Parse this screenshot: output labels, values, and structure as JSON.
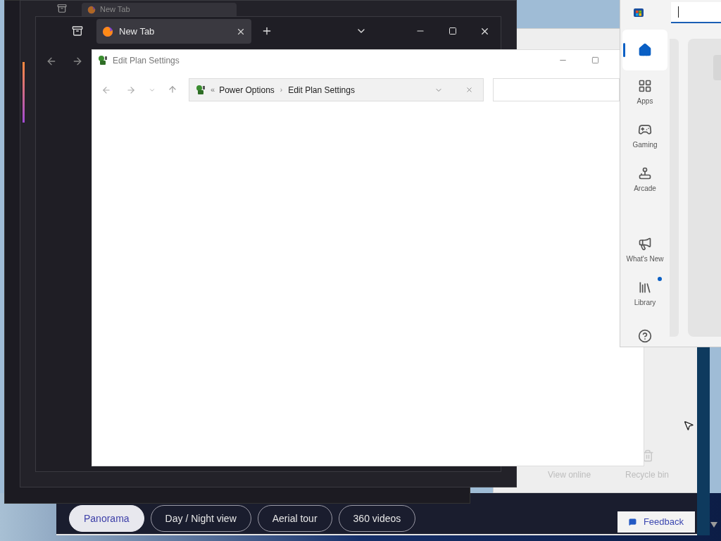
{
  "back_browser": {
    "tab": {
      "title": "New Tab"
    }
  },
  "browser": {
    "tab": {
      "title": "New Tab",
      "selected": true
    }
  },
  "explorer": {
    "title": "Edit Plan Settings",
    "overflow": "«",
    "separator": "›",
    "breadcrumb": [
      "Power Options",
      "Edit Plan Settings"
    ]
  },
  "hidden_window": {
    "actions": [
      "View online",
      "Recycle bin"
    ]
  },
  "store": {
    "nav": [
      {
        "kind": "home",
        "selected": true
      },
      {
        "kind": "apps",
        "label": "Apps",
        "selected": false
      },
      {
        "kind": "gaming",
        "label": "Gaming",
        "selected": false
      },
      {
        "kind": "arcade",
        "label": "Arcade",
        "selected": false
      },
      {
        "kind": "whats_new",
        "label": "What's New",
        "selected": false
      },
      {
        "kind": "library",
        "label": "Library",
        "selected": false,
        "badge": true
      },
      {
        "kind": "help",
        "selected": false
      }
    ]
  },
  "tour_bar": {
    "buttons": [
      {
        "label": "Panorama",
        "selected": true
      },
      {
        "label": "Day / Night view",
        "selected": false
      },
      {
        "label": "Aerial tour",
        "selected": false
      },
      {
        "label": "360 videos",
        "selected": false
      }
    ],
    "feedback": "Feedback"
  }
}
